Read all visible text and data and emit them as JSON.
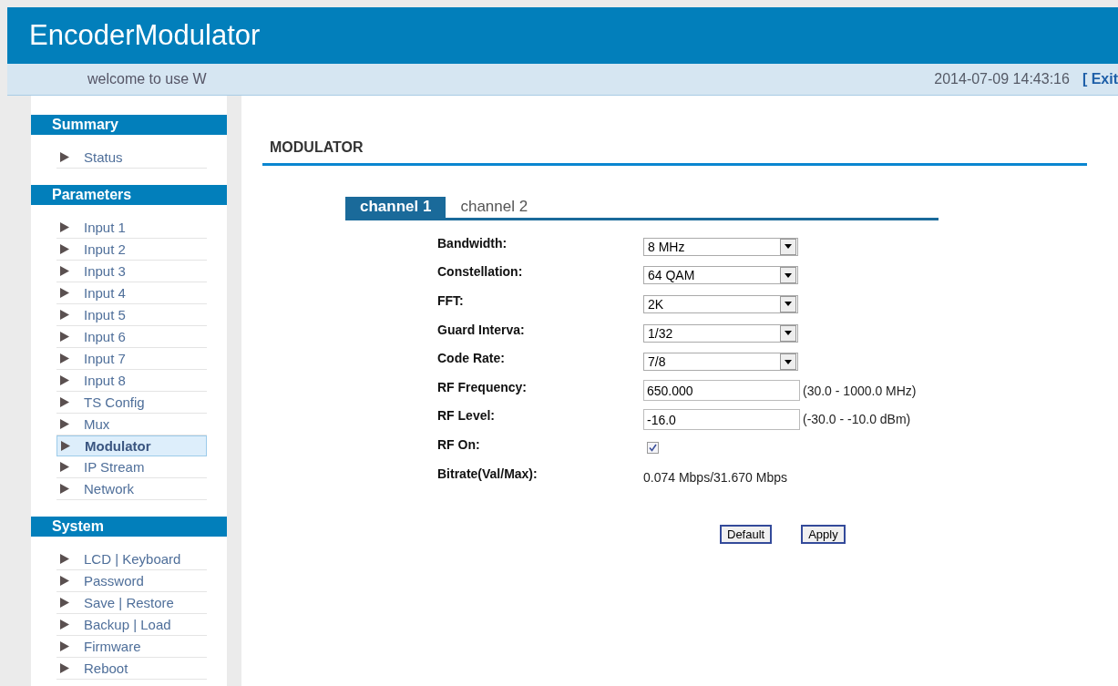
{
  "header": {
    "title": "EncoderModulator"
  },
  "info_bar": {
    "welcome": "welcome to use W",
    "datetime": "2014-07-09 14:43:16",
    "exit": "[ Exit"
  },
  "sidebar": [
    {
      "heading": "Summary",
      "items": [
        {
          "label": "Status",
          "selected": false
        }
      ]
    },
    {
      "heading": "Parameters",
      "items": [
        {
          "label": "Input 1",
          "selected": false
        },
        {
          "label": "Input 2",
          "selected": false
        },
        {
          "label": "Input 3",
          "selected": false
        },
        {
          "label": "Input 4",
          "selected": false
        },
        {
          "label": "Input 5",
          "selected": false
        },
        {
          "label": "Input 6",
          "selected": false
        },
        {
          "label": "Input 7",
          "selected": false
        },
        {
          "label": "Input 8",
          "selected": false
        },
        {
          "label": "TS Config",
          "selected": false
        },
        {
          "label": "Mux",
          "selected": false
        },
        {
          "label": "Modulator",
          "selected": true
        },
        {
          "label": "IP Stream",
          "selected": false
        },
        {
          "label": "Network",
          "selected": false
        }
      ]
    },
    {
      "heading": "System",
      "items": [
        {
          "label": "LCD | Keyboard",
          "selected": false
        },
        {
          "label": "Password",
          "selected": false
        },
        {
          "label": "Save | Restore",
          "selected": false
        },
        {
          "label": "Backup | Load",
          "selected": false
        },
        {
          "label": "Firmware",
          "selected": false
        },
        {
          "label": "Reboot",
          "selected": false
        }
      ]
    }
  ],
  "page_title": "MODULATOR",
  "tabs": [
    {
      "label": "channel 1",
      "selected": true
    },
    {
      "label": "channel 2",
      "selected": false
    }
  ],
  "fields": [
    {
      "kind": "select",
      "label": "Bandwidth:",
      "value": "8 MHz"
    },
    {
      "kind": "select",
      "label": "Constellation:",
      "value": "64 QAM"
    },
    {
      "kind": "select",
      "label": "FFT:",
      "value": "2K"
    },
    {
      "kind": "select",
      "label": "Guard Interva:",
      "value": "1/32"
    },
    {
      "kind": "select",
      "label": "Code Rate:",
      "value": "7/8"
    },
    {
      "kind": "text",
      "label": "RF Frequency:",
      "value": "650.000",
      "range": "(30.0 - 1000.0 MHz)"
    },
    {
      "kind": "text",
      "label": "RF Level:",
      "value": "-16.0",
      "range": "(-30.0 - -10.0 dBm)"
    },
    {
      "kind": "checkbox",
      "label": "RF On:",
      "checked": true
    },
    {
      "kind": "readout",
      "label": "Bitrate(Val/Max):",
      "value": "0.074 Mbps/31.670 Mbps"
    }
  ],
  "buttons": [
    "Default",
    "Apply"
  ]
}
